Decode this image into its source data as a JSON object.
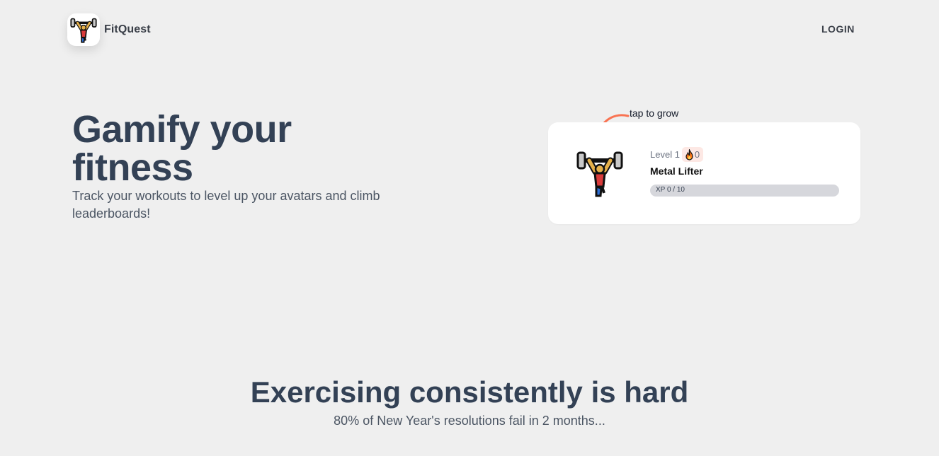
{
  "header": {
    "logo_icon": "weightlifter-icon",
    "brand": "FitQuest",
    "login_label": "LOGIN"
  },
  "hero": {
    "title": "Gamify your fitness",
    "subtitle": "Track your workouts to level up your avatars and climb leaderboards!"
  },
  "hint": {
    "text": "tap to grow",
    "arrow_icon": "curved-arrow-icon"
  },
  "avatar_card": {
    "avatar_icon": "weightlifter-icon",
    "level_label": "Level 1",
    "streak_icon": "fire-icon",
    "streak_count": "0",
    "name": "Metal Lifter",
    "xp_text": "XP 0 / 10",
    "xp_progress": 0
  },
  "section": {
    "title": "Exercising consistently is hard",
    "subtitle": "80% of New Year's resolutions fail in 2 months..."
  },
  "colors": {
    "background": "#efefef",
    "heading": "#334155",
    "accent": "#f97352",
    "card": "#ffffff",
    "xp_track": "#d6d7dc"
  }
}
